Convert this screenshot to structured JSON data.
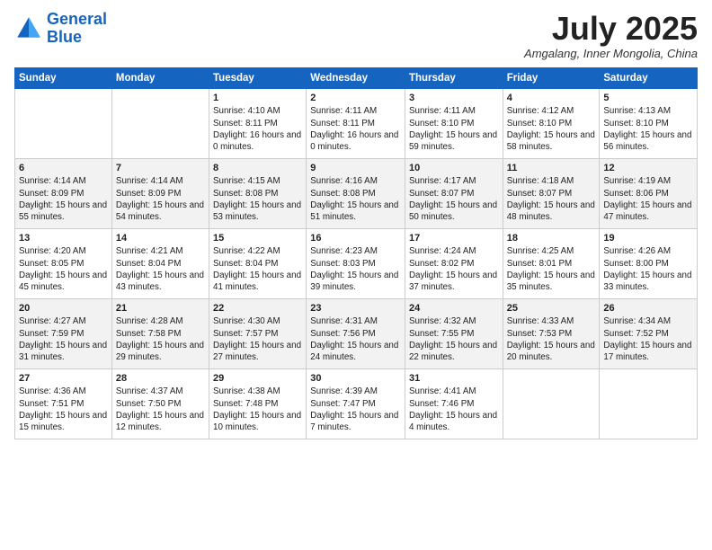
{
  "logo": {
    "line1": "General",
    "line2": "Blue"
  },
  "title": "July 2025",
  "location": "Amgalang, Inner Mongolia, China",
  "days_of_week": [
    "Sunday",
    "Monday",
    "Tuesday",
    "Wednesday",
    "Thursday",
    "Friday",
    "Saturday"
  ],
  "weeks": [
    [
      {
        "day": "",
        "info": ""
      },
      {
        "day": "",
        "info": ""
      },
      {
        "day": "1",
        "info": "Sunrise: 4:10 AM\nSunset: 8:11 PM\nDaylight: 16 hours\nand 0 minutes."
      },
      {
        "day": "2",
        "info": "Sunrise: 4:11 AM\nSunset: 8:11 PM\nDaylight: 16 hours\nand 0 minutes."
      },
      {
        "day": "3",
        "info": "Sunrise: 4:11 AM\nSunset: 8:10 PM\nDaylight: 15 hours\nand 59 minutes."
      },
      {
        "day": "4",
        "info": "Sunrise: 4:12 AM\nSunset: 8:10 PM\nDaylight: 15 hours\nand 58 minutes."
      },
      {
        "day": "5",
        "info": "Sunrise: 4:13 AM\nSunset: 8:10 PM\nDaylight: 15 hours\nand 56 minutes."
      }
    ],
    [
      {
        "day": "6",
        "info": "Sunrise: 4:14 AM\nSunset: 8:09 PM\nDaylight: 15 hours\nand 55 minutes."
      },
      {
        "day": "7",
        "info": "Sunrise: 4:14 AM\nSunset: 8:09 PM\nDaylight: 15 hours\nand 54 minutes."
      },
      {
        "day": "8",
        "info": "Sunrise: 4:15 AM\nSunset: 8:08 PM\nDaylight: 15 hours\nand 53 minutes."
      },
      {
        "day": "9",
        "info": "Sunrise: 4:16 AM\nSunset: 8:08 PM\nDaylight: 15 hours\nand 51 minutes."
      },
      {
        "day": "10",
        "info": "Sunrise: 4:17 AM\nSunset: 8:07 PM\nDaylight: 15 hours\nand 50 minutes."
      },
      {
        "day": "11",
        "info": "Sunrise: 4:18 AM\nSunset: 8:07 PM\nDaylight: 15 hours\nand 48 minutes."
      },
      {
        "day": "12",
        "info": "Sunrise: 4:19 AM\nSunset: 8:06 PM\nDaylight: 15 hours\nand 47 minutes."
      }
    ],
    [
      {
        "day": "13",
        "info": "Sunrise: 4:20 AM\nSunset: 8:05 PM\nDaylight: 15 hours\nand 45 minutes."
      },
      {
        "day": "14",
        "info": "Sunrise: 4:21 AM\nSunset: 8:04 PM\nDaylight: 15 hours\nand 43 minutes."
      },
      {
        "day": "15",
        "info": "Sunrise: 4:22 AM\nSunset: 8:04 PM\nDaylight: 15 hours\nand 41 minutes."
      },
      {
        "day": "16",
        "info": "Sunrise: 4:23 AM\nSunset: 8:03 PM\nDaylight: 15 hours\nand 39 minutes."
      },
      {
        "day": "17",
        "info": "Sunrise: 4:24 AM\nSunset: 8:02 PM\nDaylight: 15 hours\nand 37 minutes."
      },
      {
        "day": "18",
        "info": "Sunrise: 4:25 AM\nSunset: 8:01 PM\nDaylight: 15 hours\nand 35 minutes."
      },
      {
        "day": "19",
        "info": "Sunrise: 4:26 AM\nSunset: 8:00 PM\nDaylight: 15 hours\nand 33 minutes."
      }
    ],
    [
      {
        "day": "20",
        "info": "Sunrise: 4:27 AM\nSunset: 7:59 PM\nDaylight: 15 hours\nand 31 minutes."
      },
      {
        "day": "21",
        "info": "Sunrise: 4:28 AM\nSunset: 7:58 PM\nDaylight: 15 hours\nand 29 minutes."
      },
      {
        "day": "22",
        "info": "Sunrise: 4:30 AM\nSunset: 7:57 PM\nDaylight: 15 hours\nand 27 minutes."
      },
      {
        "day": "23",
        "info": "Sunrise: 4:31 AM\nSunset: 7:56 PM\nDaylight: 15 hours\nand 24 minutes."
      },
      {
        "day": "24",
        "info": "Sunrise: 4:32 AM\nSunset: 7:55 PM\nDaylight: 15 hours\nand 22 minutes."
      },
      {
        "day": "25",
        "info": "Sunrise: 4:33 AM\nSunset: 7:53 PM\nDaylight: 15 hours\nand 20 minutes."
      },
      {
        "day": "26",
        "info": "Sunrise: 4:34 AM\nSunset: 7:52 PM\nDaylight: 15 hours\nand 17 minutes."
      }
    ],
    [
      {
        "day": "27",
        "info": "Sunrise: 4:36 AM\nSunset: 7:51 PM\nDaylight: 15 hours\nand 15 minutes."
      },
      {
        "day": "28",
        "info": "Sunrise: 4:37 AM\nSunset: 7:50 PM\nDaylight: 15 hours\nand 12 minutes."
      },
      {
        "day": "29",
        "info": "Sunrise: 4:38 AM\nSunset: 7:48 PM\nDaylight: 15 hours\nand 10 minutes."
      },
      {
        "day": "30",
        "info": "Sunrise: 4:39 AM\nSunset: 7:47 PM\nDaylight: 15 hours\nand 7 minutes."
      },
      {
        "day": "31",
        "info": "Sunrise: 4:41 AM\nSunset: 7:46 PM\nDaylight: 15 hours\nand 4 minutes."
      },
      {
        "day": "",
        "info": ""
      },
      {
        "day": "",
        "info": ""
      }
    ]
  ]
}
